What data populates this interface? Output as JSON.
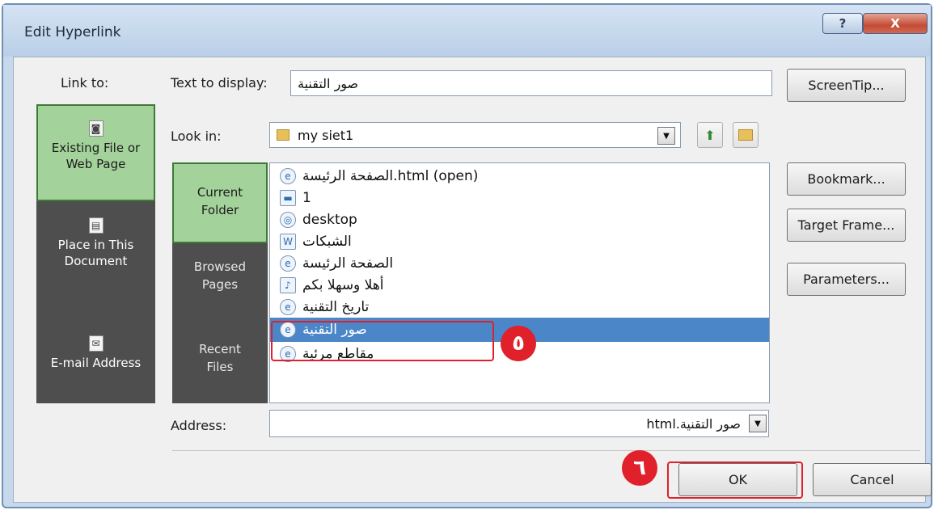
{
  "window": {
    "title": "Edit Hyperlink",
    "help_label": "?",
    "close_label": "X"
  },
  "link_to": {
    "heading": "Link to:",
    "items": [
      {
        "label_line1": "Existing File or",
        "label_line2": "Web Page",
        "icon": "document-icon",
        "selected": true
      },
      {
        "label_line1": "Place in This",
        "label_line2": "Document",
        "icon": "place-in-document-icon",
        "selected": false
      },
      {
        "label_line1": "E-mail Address",
        "label_line2": "",
        "icon": "email-icon",
        "selected": false
      }
    ]
  },
  "text_to_display": {
    "label": "Text to display:",
    "value": "صور التقنية"
  },
  "look_in": {
    "label": "Look in:",
    "value": "my siet1"
  },
  "places": [
    {
      "line1": "Current",
      "line2": "Folder",
      "selected": true
    },
    {
      "line1": "Browsed",
      "line2": "Pages",
      "selected": false
    },
    {
      "line1": "Recent",
      "line2": "Files",
      "selected": false
    }
  ],
  "files": [
    {
      "name": "الصفحة الرئيسة.html (open)",
      "icon": "ie-icon"
    },
    {
      "name": "1",
      "icon": "image-icon"
    },
    {
      "name": "desktop",
      "icon": "desktop-icon"
    },
    {
      "name": "الشبكات",
      "icon": "word-doc-icon"
    },
    {
      "name": "الصفحة الرئيسة",
      "icon": "ie-icon"
    },
    {
      "name": "أهلا وسهلا بكم",
      "icon": "audio-icon"
    },
    {
      "name": "تاريخ التقنية",
      "icon": "ie-icon"
    },
    {
      "name": "صور التقنية",
      "icon": "ie-icon",
      "selected": true
    },
    {
      "name": "مقاطع مرئية",
      "icon": "ie-icon"
    }
  ],
  "address": {
    "label": "Address:",
    "value": "صور التقنية.html"
  },
  "buttons": {
    "screentip": "ScreenTip...",
    "bookmark": "Bookmark...",
    "target_frame": "Target Frame...",
    "parameters": "Parameters...",
    "ok": "OK",
    "cancel": "Cancel"
  },
  "annotations": {
    "step5": "٥",
    "step6": "٦"
  }
}
